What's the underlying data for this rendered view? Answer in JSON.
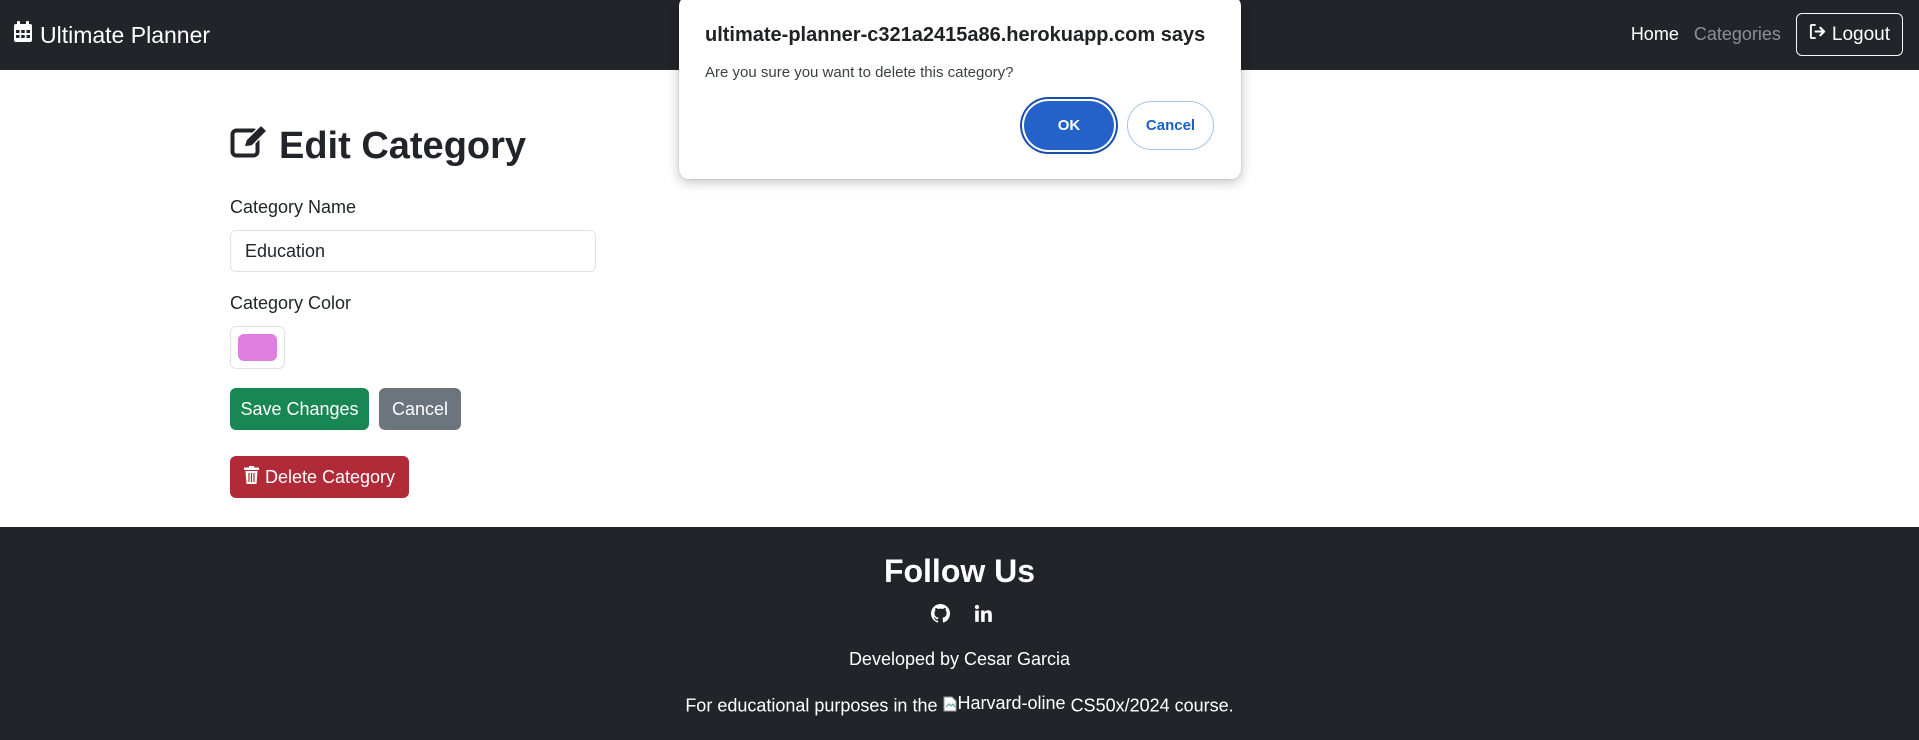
{
  "navbar": {
    "brand": "Ultimate Planner",
    "brand_icon": "calendar-icon",
    "links": {
      "home": "Home",
      "categories": "Categories"
    },
    "logout_label": "Logout",
    "logout_icon": "sign-out-icon"
  },
  "main": {
    "title": "Edit Category",
    "title_icon": "edit-icon",
    "name_label": "Category Name",
    "name_value": "Education",
    "color_label": "Category Color",
    "color_value": "#e07ee0",
    "save_label": "Save Changes",
    "cancel_label": "Cancel",
    "delete_label": "Delete Category",
    "delete_icon": "trash-icon"
  },
  "footer": {
    "title": "Follow Us",
    "social": [
      "github-icon",
      "linkedin-icon"
    ],
    "developed_by": "Developed by Cesar Garcia",
    "edu_prefix": "For educational purposes in the",
    "edu_image_alt": "Harvard-oline",
    "edu_suffix": "CS50x/2024 course."
  },
  "dialog": {
    "title": "ultimate-planner-c321a2415a86.herokuapp.com says",
    "message": "Are you sure you want to delete this category?",
    "ok_label": "OK",
    "cancel_label": "Cancel"
  },
  "colors": {
    "navbar_bg": "#212529",
    "success": "#198754",
    "secondary": "#6c757d",
    "danger": "#b02a37",
    "dialog_accent": "#2462c9"
  }
}
